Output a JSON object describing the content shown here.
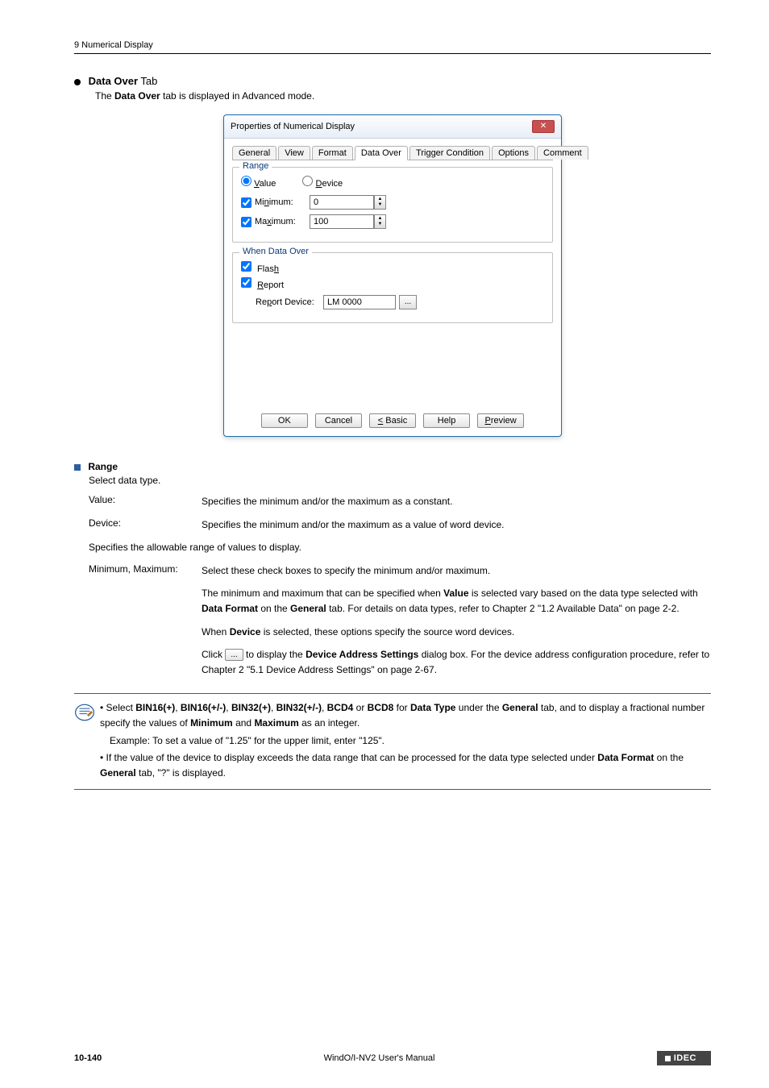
{
  "header": {
    "section": "9 Numerical Display"
  },
  "title": {
    "tab_name": "Data Over",
    "suffix": " Tab",
    "subtitle_prefix": "The ",
    "subtitle_bold": "Data Over",
    "subtitle_suffix": " tab is displayed in Advanced mode."
  },
  "dialog": {
    "title": "Properties of Numerical Display",
    "close_x": "✕",
    "tabs": [
      "General",
      "View",
      "Format",
      "Data Over",
      "Trigger Condition",
      "Options",
      "Comment"
    ],
    "range_group": "Range",
    "radio_value": "Value",
    "radio_device": "Device",
    "minimum_label": "Minimum:",
    "minimum_value": "0",
    "maximum_label": "Maximum:",
    "maximum_value": "100",
    "when_group": "When Data Over",
    "flash_label": "Flash",
    "report_label": "Report",
    "report_device_label": "Report Device:",
    "report_device_value": "LM 0000",
    "browse": "...",
    "btn_ok": "OK",
    "btn_cancel": "Cancel",
    "btn_basic": "< Basic",
    "btn_help": "Help",
    "btn_preview": "Preview"
  },
  "range": {
    "heading": "Range",
    "sub": "Select data type.",
    "value_key": "Value:",
    "value_desc": "Specifies the minimum and/or the maximum as a constant.",
    "device_key": "Device:",
    "device_desc": "Specifies the minimum and/or the maximum as a value of word device.",
    "allow_desc": "Specifies the allowable range of values to display.",
    "mm_key": "Minimum, Maximum:",
    "mm_desc1": "Select these check boxes to specify the minimum and/or maximum.",
    "mm_desc2a": "The minimum and maximum that can be specified when ",
    "mm_desc2b": "Value",
    "mm_desc2c": " is selected vary based on the data type selected with ",
    "mm_desc2d": "Data Format",
    "mm_desc2e": " on the ",
    "mm_desc2f": "General",
    "mm_desc2g": " tab. For details on data types, refer to Chapter 2 \"1.2 Available Data\" on page 2-2.",
    "mm_desc3a": "When ",
    "mm_desc3b": "Device",
    "mm_desc3c": " is selected, these options specify the source word devices.",
    "mm_desc4a": "Click ",
    "mm_desc4_btn": "...",
    "mm_desc4b": " to display the ",
    "mm_desc4c": "Device Address Settings",
    "mm_desc4d": " dialog box. For the device address configuration procedure, refer to Chapter 2 \"5.1 Device Address Settings\" on page 2-67."
  },
  "note": {
    "l1a": "Select ",
    "l1b": "BIN16(+)",
    "l1c": ", ",
    "l1d": "BIN16(+/-)",
    "l1e": ", ",
    "l1f": "BIN32(+)",
    "l1g": ", ",
    "l1h": "BIN32(+/-)",
    "l1i": ", ",
    "l1j": "BCD4",
    "l1k": " or ",
    "l1l": "BCD8",
    "l1m": " for ",
    "l1n": "Data Type",
    "l1o": " under the ",
    "l2a": "General",
    "l2b": " tab, and to display a fractional number specify the values of ",
    "l2c": "Minimum",
    "l2d": " and ",
    "l2e": "Maximum",
    "l2f": " as an integer.",
    "l3": "Example: To set a value of \"1.25\" for the upper limit, enter \"125\".",
    "l4": "If the value of the device to display exceeds the data range that can be processed for the data type",
    "l5a": "selected under ",
    "l5b": "Data Format",
    "l5c": " on the ",
    "l5d": "General",
    "l5e": " tab, \"?\" is displayed."
  },
  "footer": {
    "page_num": "10-140",
    "manual": "WindO/I-NV2 User's Manual",
    "logo": "IDEC"
  }
}
